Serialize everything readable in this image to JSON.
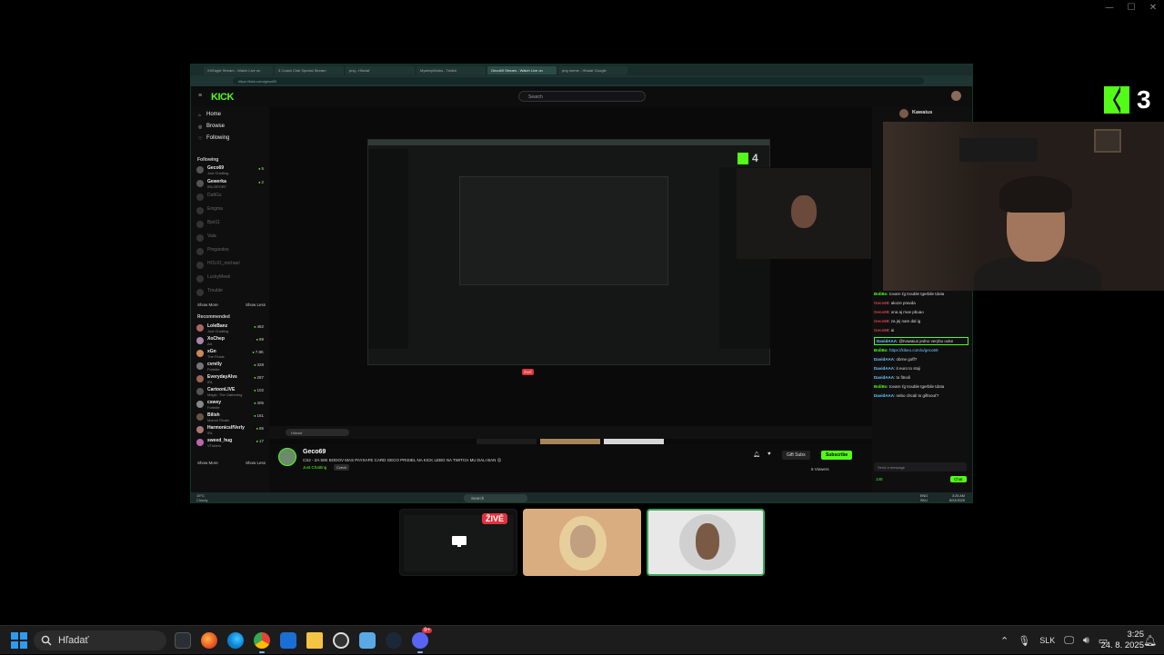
{
  "window": {
    "min": "—",
    "max": "☐",
    "close": "✕"
  },
  "overlay_logo": {
    "num": "3"
  },
  "browser": {
    "tabs": [
      "XXEagle Stream - Watch Live on",
      "3 Coach Club Special Stream",
      "png - Hľadať",
      "MysteryWorks - Twitch",
      "Geco69 Stream - Watch Live on",
      "png meme - Hľadať Google"
    ],
    "address": "https://kick.com/geco69"
  },
  "kick": {
    "search_placeholder": "Search",
    "nav": [
      "Home",
      "Browse",
      "Following"
    ],
    "following_title": "Following",
    "following": [
      {
        "name": "Geco69",
        "cat": "Just Chatting",
        "viewers": "5"
      },
      {
        "name": "Gewerka",
        "cat": "IRL/SPORT",
        "viewers": "2"
      },
      {
        "name": "DaftGs",
        "cat": "",
        "viewers": "off"
      },
      {
        "name": "Enigma",
        "cat": "",
        "viewers": "off"
      },
      {
        "name": "Bjot11",
        "cat": "",
        "viewers": "off"
      },
      {
        "name": "Vala",
        "cat": "",
        "viewers": "off"
      },
      {
        "name": "Pingandos",
        "cat": "",
        "viewers": "off"
      },
      {
        "name": "HOLIO_michael",
        "cat": "",
        "viewers": "off"
      },
      {
        "name": "LuckyMeek",
        "cat": "",
        "viewers": "off"
      },
      {
        "name": "Trouble",
        "cat": "",
        "viewers": "off"
      }
    ],
    "show_more": "Show More",
    "show_less": "Show Less",
    "recommended_title": "Recommended",
    "recommended": [
      {
        "name": "LoleBanz",
        "cat": "Just Chatting",
        "viewers": "482"
      },
      {
        "name": "XoChep",
        "cat": "Art",
        "viewers": "99"
      },
      {
        "name": "xGn",
        "cat": "The Finals",
        "viewers": "7.8K"
      },
      {
        "name": "cvrelly",
        "cat": "Fortnite",
        "viewers": "328"
      },
      {
        "name": "EverydayAlvs",
        "cat": "IRL",
        "viewers": "287"
      },
      {
        "name": "CartoonLIVE",
        "cat": "Magic: The Gathering",
        "viewers": "102"
      },
      {
        "name": "cswey",
        "cat": "Fortnite",
        "viewers": "405"
      },
      {
        "name": "Bilish",
        "cat": "Marvel Rivals",
        "viewers": "161"
      },
      {
        "name": "HarmonicsIfVerly",
        "cat": "IRL",
        "viewers": "86"
      },
      {
        "name": "sweed_hug",
        "cat": "VTubers",
        "viewers": "17"
      }
    ],
    "nested_logo_num": "4",
    "nested_live": "ŽIVÉ",
    "inner_taskbar_search": "Hľadať"
  },
  "stream_info": {
    "name": "Geco69",
    "title": "CS2 - ZA 50K BODOV MAS PAYSAFE CARD  GECO PRISIEL NA KICK LEBO NA TWITCH MU DALI BAN ☹",
    "category": "Just Chatting",
    "tag": "Czech",
    "gift": "Gift Subs",
    "subscribe": "Subscribe",
    "viewers": "5 Viewers"
  },
  "chat": {
    "header": "Kawaius",
    "messages": [
      {
        "user": "BoliBo",
        "text": "tovarn ťg trouble tgerbile tdota",
        "style": "g"
      },
      {
        "user": "Geco69",
        "text": "akoze pravda",
        "style": "r"
      },
      {
        "user": "Geco69",
        "text": "ona aj moe pbuao",
        "style": "r"
      },
      {
        "user": "Geco69",
        "text": "za jej nam dal ig",
        "style": "r"
      },
      {
        "user": "Geco69",
        "text": "ai",
        "style": "r"
      },
      {
        "user": "DavidAAA",
        "text": "@Kawaius jedno verybu ooke",
        "style": "c",
        "hl": true
      },
      {
        "user": "BoliBo",
        "text": "https://kikeo.com/u/geco69",
        "style": "g"
      },
      {
        "user": "DavidAAA",
        "text": "obrne goff?",
        "style": "c"
      },
      {
        "user": "DavidAAA",
        "text": "it euro to stoji",
        "style": "c"
      },
      {
        "user": "DavidAAA",
        "text": "to fitnoli",
        "style": "c"
      },
      {
        "user": "BoliBo",
        "text": "tovarn ťg trouble tgerbile tdota",
        "style": "g"
      },
      {
        "user": "DavidAAA",
        "text": "nebo chcali to giftnouť?",
        "style": "c"
      }
    ],
    "input_placeholder": "Send a message",
    "points": "140",
    "send": "Chat"
  },
  "inner_taskbar": {
    "search": "Search",
    "weather_temp": "19°C",
    "weather_desc": "Cloudy",
    "lang": "ENG",
    "lang2": "SKU",
    "time": "3:25 AM",
    "date": "8/24/2025"
  },
  "participants": {
    "live": "ŽIVÉ"
  },
  "taskbar": {
    "search": "Hľadať",
    "lang": "SLK",
    "time": "3:25",
    "date": "24. 8. 2025",
    "discord_badge": "9+"
  },
  "colors": {
    "kick_green": "#53fc18",
    "live_red": "#e0333d",
    "accent_blue": "#2e9bf0"
  }
}
